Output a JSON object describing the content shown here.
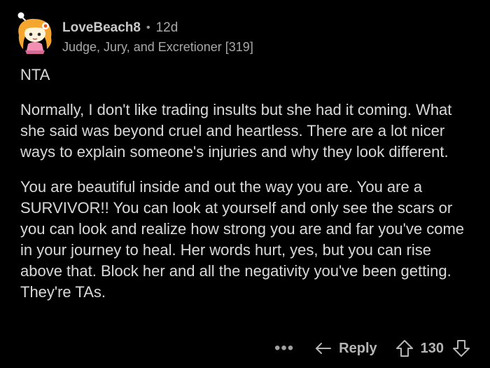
{
  "comment": {
    "username": "LoveBeach8",
    "separator": "•",
    "age": "12d",
    "flair": "Judge, Jury, and Excretioner [319]",
    "paragraphs": [
      "NTA",
      "Normally, I don't like trading insults but she had it coming. What she said was beyond cruel and heartless. There are a lot nicer ways to explain someone's injuries and why they look different.",
      "You are beautiful inside and out the way you are. You are a SURVIVOR!! You can look at yourself and only see the scars or you can look and realize how strong you are and far you've come in your journey to heal. Her words hurt, yes, but you can rise above that. Block her and all the negativity you've been getting. They're TAs."
    ]
  },
  "actions": {
    "more_label": "•••",
    "reply_label": "Reply",
    "score": "130"
  },
  "icons": {
    "more": "more-options-icon",
    "reply": "reply-arrow-icon",
    "upvote": "upvote-arrow-icon",
    "downvote": "downvote-arrow-icon"
  },
  "colors": {
    "background": "#000000",
    "text": "#d9d9d9",
    "muted": "#a8a8a8"
  }
}
